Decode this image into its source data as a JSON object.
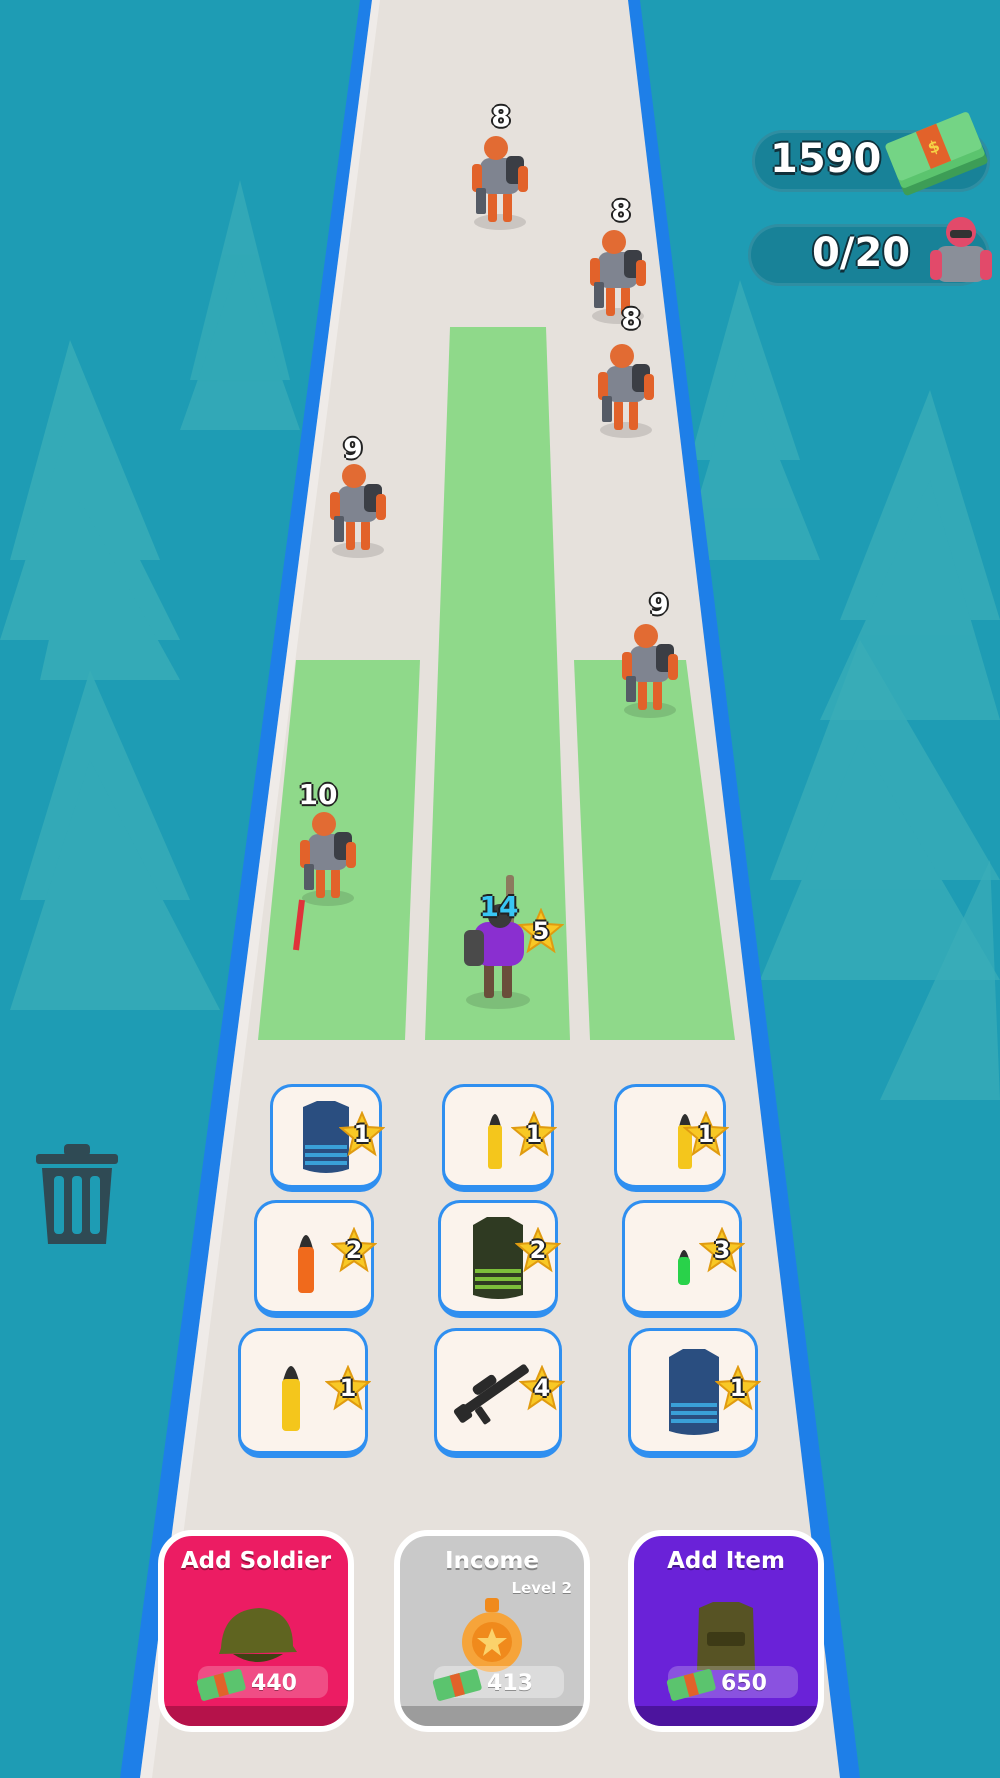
{
  "hud": {
    "money": "1590",
    "soldiers": "0/20"
  },
  "enemies": [
    {
      "level": "8"
    },
    {
      "level": "8"
    },
    {
      "level": "8"
    },
    {
      "level": "9"
    },
    {
      "level": "9"
    },
    {
      "level": "10"
    }
  ],
  "player": {
    "level": "14",
    "star_level": "5"
  },
  "grid": [
    {
      "item": "vest-blue",
      "level": "1"
    },
    {
      "item": "bullet-yellow",
      "level": "1"
    },
    {
      "item": "bullet-yellow",
      "level": "1"
    },
    {
      "item": "bullet-orange",
      "level": "2"
    },
    {
      "item": "vest-green",
      "level": "2"
    },
    {
      "item": "bullet-green",
      "level": "3"
    },
    {
      "item": "bullet-yellow",
      "level": "1"
    },
    {
      "item": "rifle",
      "level": "4"
    },
    {
      "item": "vest-blue",
      "level": "1"
    }
  ],
  "buttons": {
    "add_soldier": {
      "title": "Add Soldier",
      "price": "440",
      "color": "#ec1c63"
    },
    "income": {
      "title": "Income",
      "level": "Level 2",
      "price": "413",
      "color": "#c9c9c9"
    },
    "add_item": {
      "title": "Add Item",
      "price": "650",
      "color": "#6a22d8"
    }
  },
  "colors": {
    "background": "#1e9cb4",
    "track": "#e6e1dc",
    "track_border": "#1e7fe8",
    "lane": "#8fd98a"
  }
}
